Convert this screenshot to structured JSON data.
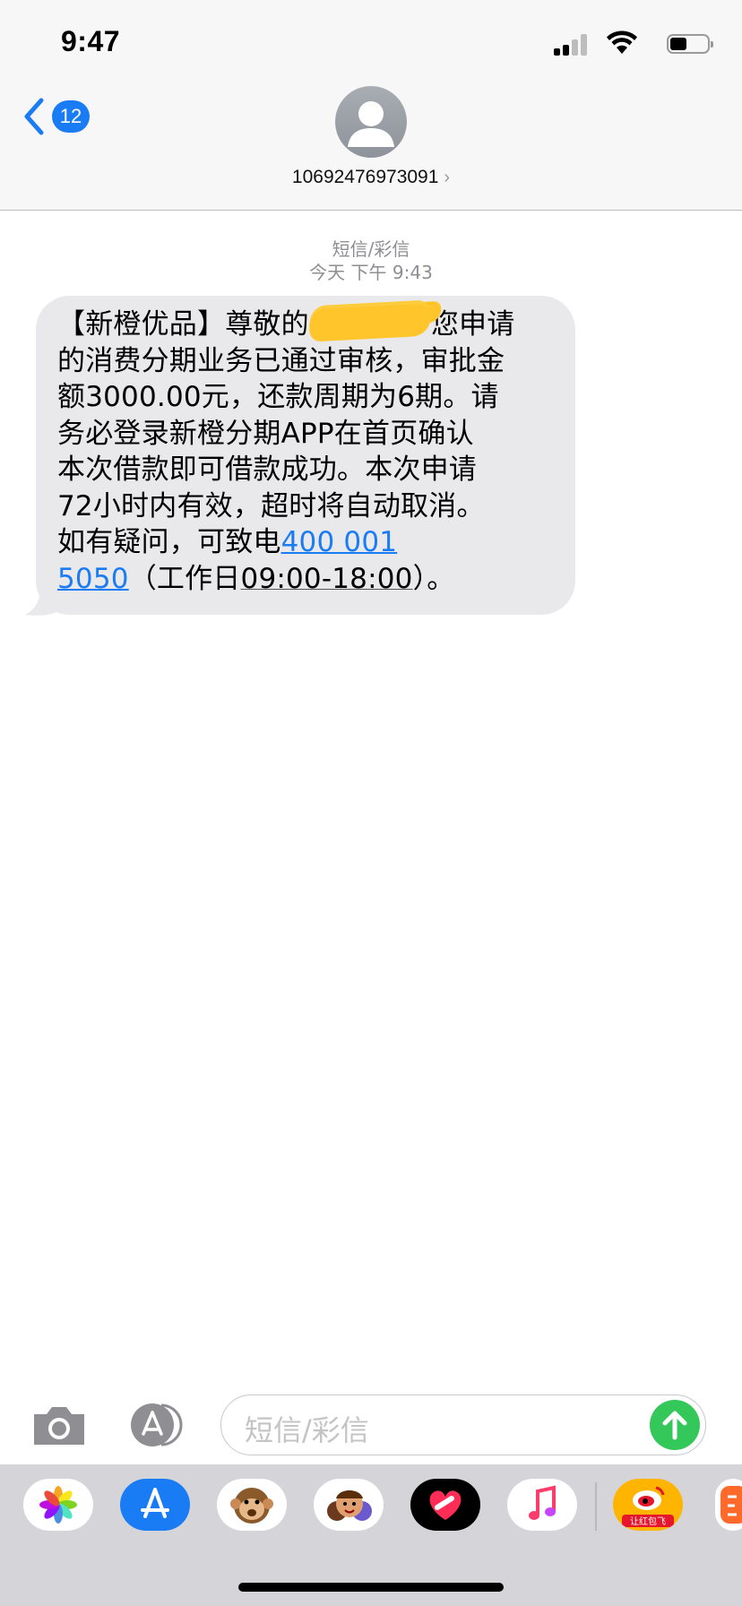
{
  "status_bar": {
    "time": "9:47",
    "battery_level": 0.45
  },
  "nav": {
    "back_badge": "12",
    "contact": "10692476973091"
  },
  "thread": {
    "service_label": "短信/彩信",
    "timestamp": "今天 下午 9:43",
    "message": {
      "line1_before": "【新橙优品】尊敬的",
      "line1_after": "您申请",
      "line2": "的消费分期业务已通过审核，审批金",
      "line3": "额3000.00元，还款周期为6期。请",
      "line4": "务必登录新橙分期APP在首页确认",
      "line5": "本次借款即可借款成功。本次申请",
      "line6": "72小时内有效，超时将自动取消。",
      "line7_before": "如有疑问，可致电",
      "phone_part1": "400 001",
      "phone_part2": "5050",
      "line8_open": "（工作日",
      "hours": "09:00-18:00",
      "line8_close": "）。"
    }
  },
  "composer": {
    "placeholder": "短信/彩信"
  },
  "app_drawer": {
    "apps": [
      "photos-app",
      "app-store-app",
      "animoji-app",
      "memoji-app",
      "digital-touch-app",
      "music-app",
      "weibo-app",
      "partial-app"
    ],
    "weibo_badge_text": "让红包飞"
  },
  "colors": {
    "accent": "#1a7cf5",
    "send": "#34c759",
    "bubble": "#e9e9eb",
    "redaction": "#ffc52b"
  }
}
